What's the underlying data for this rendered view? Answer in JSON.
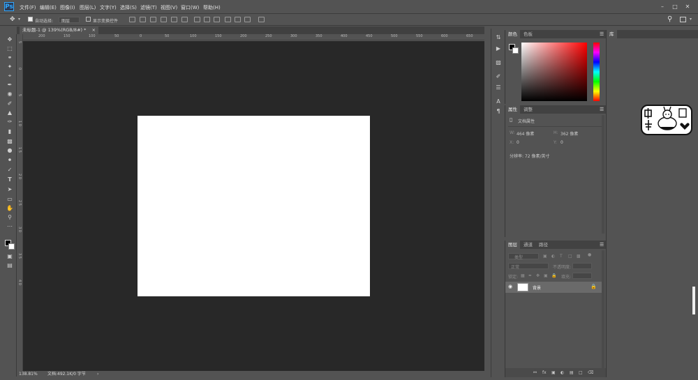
{
  "app": {
    "logo": "Ps"
  },
  "menu": [
    "文件(F)",
    "编辑(E)",
    "图像(I)",
    "图层(L)",
    "文字(Y)",
    "选择(S)",
    "滤镜(T)",
    "视图(V)",
    "窗口(W)",
    "帮助(H)"
  ],
  "options": {
    "auto_select_label": "自动选择:",
    "auto_select_value": "图层",
    "show_transform_label": "显示变换控件"
  },
  "document": {
    "tab_title": "未标题-1 @ 139%(RGB/8#) *"
  },
  "ruler_top": [
    "200",
    "150",
    "100",
    "50",
    "0",
    "50",
    "100",
    "150",
    "200",
    "250",
    "300",
    "350",
    "400",
    "450",
    "500",
    "550",
    "600",
    "650"
  ],
  "ruler_left": [
    "5",
    "0",
    "5",
    "1 0",
    "1 5",
    "2 0",
    "2 5",
    "3 0",
    "3 5",
    "4 0"
  ],
  "status": {
    "zoom": "138.81%",
    "doc_info": "文档:492.1K/0 字节"
  },
  "color_panel": {
    "tabs": [
      "颜色",
      "色板"
    ]
  },
  "properties_panel": {
    "tabs": [
      "属性",
      "调整"
    ],
    "title": "文档属性",
    "w_label": "W:",
    "w_value": "464 像素",
    "h_label": "H:",
    "h_value": "362 像素",
    "x_label": "X:",
    "x_value": "0",
    "y_label": "Y:",
    "y_value": "0",
    "resolution": "分辨率: 72 像素/英寸"
  },
  "layers_panel": {
    "tabs": [
      "图层",
      "通道",
      "路径"
    ],
    "filter_placeholder": "类型",
    "blend_mode": "正常",
    "opacity_label": "不透明度:",
    "lock_label": "锁定:",
    "fill_label": "填充:",
    "layer_name": "背景"
  },
  "library_panel": {
    "tab": "库"
  },
  "colors": {
    "ui": "#535353",
    "canvas": "#282828",
    "accent": "#31a8ff"
  }
}
